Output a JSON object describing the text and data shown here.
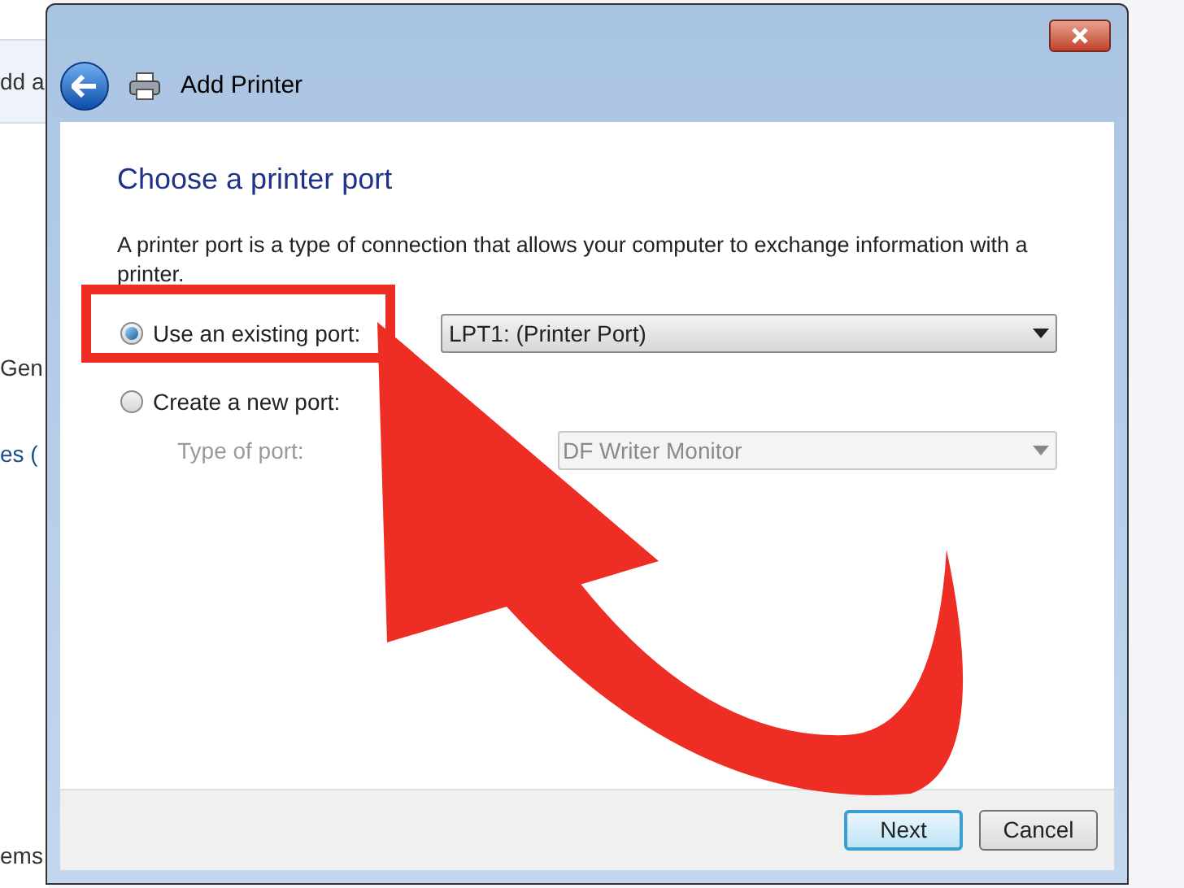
{
  "background_window": {
    "texts": [
      "dd a",
      "Gen",
      "es (",
      "ems"
    ]
  },
  "dialog": {
    "title": "Add Printer",
    "heading": "Choose a printer port",
    "description": "A printer port is a type of connection that allows your computer to exchange information with a printer.",
    "options": [
      {
        "label": "Use an existing port:",
        "selected": true,
        "value": "LPT1: (Printer Port)"
      },
      {
        "label": "Create a new port:",
        "selected": false
      }
    ],
    "port_type": {
      "label": "Type of port:",
      "value": "DF Writer Monitor",
      "disabled": true
    },
    "buttons": [
      {
        "label": "Next",
        "default": true
      },
      {
        "label": "Cancel",
        "default": false
      }
    ]
  }
}
